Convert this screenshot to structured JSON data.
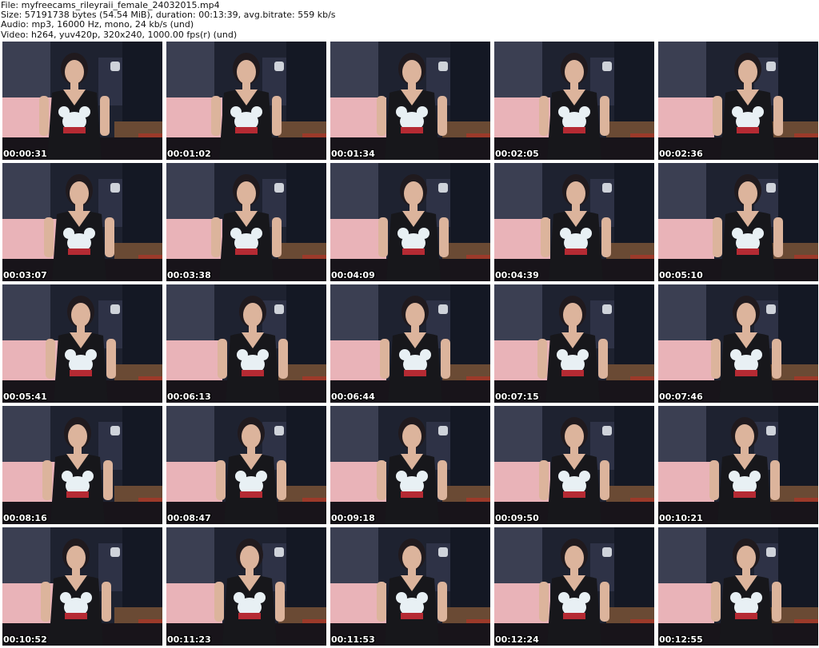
{
  "header": {
    "file_line": "File: myfreecams_rileyraii_female_24032015.mp4",
    "size_line": "Size: 57191738 bytes (54.54 MiB), duration: 00:13:39, avg.bitrate: 559 kb/s",
    "audio_line": "Audio: mp3, 16000 Hz, mono, 24 kb/s (und)",
    "video_line": "Video: h264, yuv420p, 320x240, 1000.00 fps(r) (und)"
  },
  "thumbnails": [
    {
      "time": "00:00:31"
    },
    {
      "time": "00:01:02"
    },
    {
      "time": "00:01:34"
    },
    {
      "time": "00:02:05"
    },
    {
      "time": "00:02:36"
    },
    {
      "time": "00:03:07"
    },
    {
      "time": "00:03:38"
    },
    {
      "time": "00:04:09"
    },
    {
      "time": "00:04:39"
    },
    {
      "time": "00:05:10"
    },
    {
      "time": "00:05:41"
    },
    {
      "time": "00:06:13"
    },
    {
      "time": "00:06:44"
    },
    {
      "time": "00:07:15"
    },
    {
      "time": "00:07:46"
    },
    {
      "time": "00:08:16"
    },
    {
      "time": "00:08:47"
    },
    {
      "time": "00:09:18"
    },
    {
      "time": "00:09:50"
    },
    {
      "time": "00:10:21"
    },
    {
      "time": "00:10:52"
    },
    {
      "time": "00:11:23"
    },
    {
      "time": "00:11:53"
    },
    {
      "time": "00:12:24"
    },
    {
      "time": "00:12:55"
    }
  ],
  "colors": {
    "background": "#ffffff",
    "wall": "#1e2230",
    "bed": "#e9b3b8",
    "shirt": "#17171b",
    "skin": "#dcb49c",
    "hair": "#201a1e",
    "mouse_print": "#e8f0f4",
    "red_print": "#b52a33"
  }
}
